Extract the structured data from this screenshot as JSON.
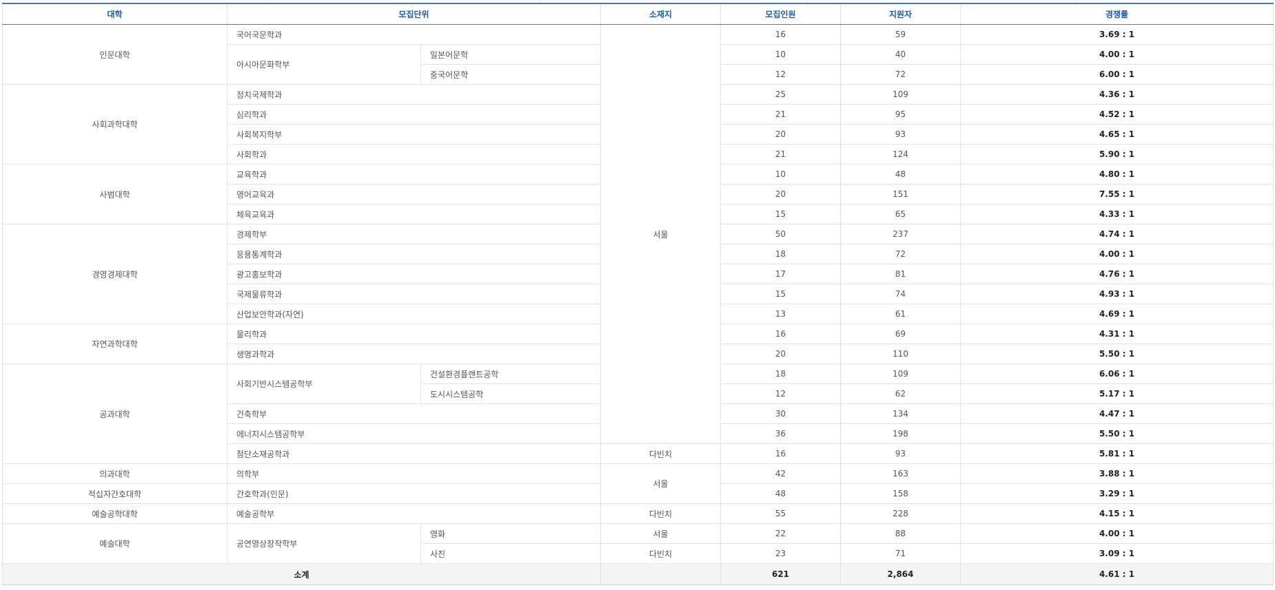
{
  "headers": {
    "college": "대학",
    "unit": "모집단위",
    "location": "소재지",
    "quota": "모집인원",
    "applicants": "지원자",
    "ratio": "경쟁률"
  },
  "colleges": {
    "humanities": "인문대학",
    "social": "사회과학대학",
    "education": "사범대학",
    "business": "경영경제대학",
    "science": "자연과학대학",
    "engineering": "공과대학",
    "medicine": "의과대학",
    "nursing": "적십자간호대학",
    "arttech": "예술공학대학",
    "arts": "예술대학"
  },
  "groups": {
    "asia": "아시아문화학부",
    "civil": "사회기반시스템공학부",
    "film": "공연영상창작학부"
  },
  "locations": {
    "seoul_main": "서울",
    "davinci_1": "다빈치",
    "seoul_2": "서울",
    "davinci_2": "다빈치",
    "seoul_3": "서울",
    "davinci_3": "다빈치"
  },
  "rows": [
    {
      "unit": "국어국문학과",
      "quota": "16",
      "applicants": "59",
      "ratio": "3.69 : 1"
    },
    {
      "unit": "일본어문학",
      "quota": "10",
      "applicants": "40",
      "ratio": "4.00 : 1"
    },
    {
      "unit": "중국어문학",
      "quota": "12",
      "applicants": "72",
      "ratio": "6.00 : 1"
    },
    {
      "unit": "정치국제학과",
      "quota": "25",
      "applicants": "109",
      "ratio": "4.36 : 1"
    },
    {
      "unit": "심리학과",
      "quota": "21",
      "applicants": "95",
      "ratio": "4.52 : 1"
    },
    {
      "unit": "사회복지학부",
      "quota": "20",
      "applicants": "93",
      "ratio": "4.65 : 1"
    },
    {
      "unit": "사회학과",
      "quota": "21",
      "applicants": "124",
      "ratio": "5.90 : 1"
    },
    {
      "unit": "교육학과",
      "quota": "10",
      "applicants": "48",
      "ratio": "4.80 : 1"
    },
    {
      "unit": "영어교육과",
      "quota": "20",
      "applicants": "151",
      "ratio": "7.55 : 1"
    },
    {
      "unit": "체육교육과",
      "quota": "15",
      "applicants": "65",
      "ratio": "4.33 : 1"
    },
    {
      "unit": "경제학부",
      "quota": "50",
      "applicants": "237",
      "ratio": "4.74 : 1"
    },
    {
      "unit": "응용통계학과",
      "quota": "18",
      "applicants": "72",
      "ratio": "4.00 : 1"
    },
    {
      "unit": "광고홍보학과",
      "quota": "17",
      "applicants": "81",
      "ratio": "4.76 : 1"
    },
    {
      "unit": "국제물류학과",
      "quota": "15",
      "applicants": "74",
      "ratio": "4.93 : 1"
    },
    {
      "unit": "산업보안학과(자연)",
      "quota": "13",
      "applicants": "61",
      "ratio": "4.69 : 1"
    },
    {
      "unit": "물리학과",
      "quota": "16",
      "applicants": "69",
      "ratio": "4.31 : 1"
    },
    {
      "unit": "생명과학과",
      "quota": "20",
      "applicants": "110",
      "ratio": "5.50 : 1"
    },
    {
      "unit": "건설환경플랜트공학",
      "quota": "18",
      "applicants": "109",
      "ratio": "6.06 : 1"
    },
    {
      "unit": "도시시스템공학",
      "quota": "12",
      "applicants": "62",
      "ratio": "5.17 : 1"
    },
    {
      "unit": "건축학부",
      "quota": "30",
      "applicants": "134",
      "ratio": "4.47 : 1"
    },
    {
      "unit": "에너지시스템공학부",
      "quota": "36",
      "applicants": "198",
      "ratio": "5.50 : 1"
    },
    {
      "unit": "첨단소재공학과",
      "quota": "16",
      "applicants": "93",
      "ratio": "5.81 : 1"
    },
    {
      "unit": "의학부",
      "quota": "42",
      "applicants": "163",
      "ratio": "3.88 : 1"
    },
    {
      "unit": "간호학과(인문)",
      "quota": "48",
      "applicants": "158",
      "ratio": "3.29 : 1"
    },
    {
      "unit": "예술공학부",
      "quota": "55",
      "applicants": "228",
      "ratio": "4.15 : 1"
    },
    {
      "unit": "영화",
      "quota": "22",
      "applicants": "88",
      "ratio": "4.00 : 1"
    },
    {
      "unit": "사진",
      "quota": "23",
      "applicants": "71",
      "ratio": "3.09 : 1"
    }
  ],
  "total": {
    "label": "소계",
    "quota": "621",
    "applicants": "2,864",
    "ratio": "4.61 : 1"
  }
}
